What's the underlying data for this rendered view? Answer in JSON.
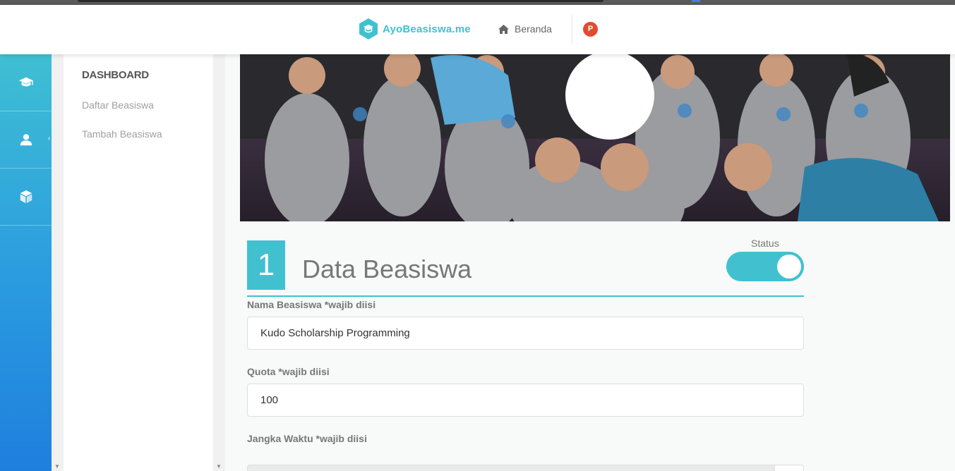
{
  "app": {
    "brand": "AyoBeasiswa.me",
    "accent_color": "#41c1d0"
  },
  "navbar": {
    "home_label": "Beranda",
    "home_icon": "home-icon",
    "avatar_text": "P",
    "avatar_color": "#e64a2e"
  },
  "icon_sidebar": {
    "items": [
      {
        "icon": "graduation-cap-icon"
      },
      {
        "icon": "user-icon"
      },
      {
        "icon": "cube-icon"
      }
    ]
  },
  "menu": {
    "title": "DASHBOARD",
    "items": [
      {
        "label": "Daftar Beasiswa"
      },
      {
        "label": "Tambah Beasiswa"
      }
    ]
  },
  "section": {
    "number": "1",
    "title": "Data Beasiswa",
    "status_label": "Status",
    "status_on": true
  },
  "form": {
    "nama": {
      "label": "Nama Beasiswa *wajib diisi",
      "value": "Kudo Scholarship Programming"
    },
    "quota": {
      "label": "Quota *wajib diisi",
      "value": "100"
    },
    "jangka_waktu": {
      "label": "Jangka Waktu *wajib diisi"
    }
  }
}
